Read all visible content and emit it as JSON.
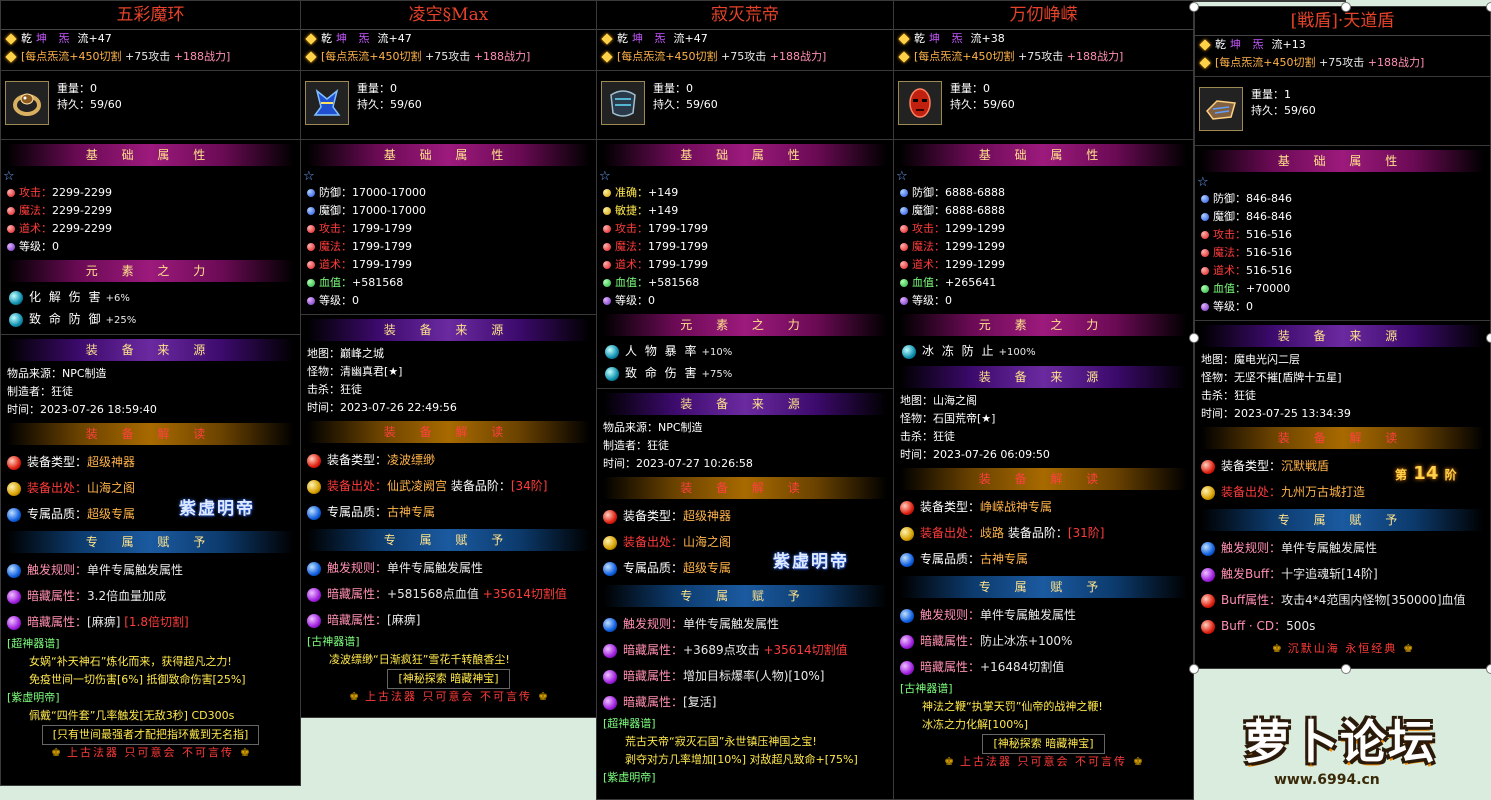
{
  "header_common": {
    "qian": "乾",
    "yinyang": "坤 炁",
    "liu": "流+",
    "bonus_a": "[每点炁流+450切割",
    "bonus_b": "+75攻击",
    "bonus_c": "+188战力]"
  },
  "labels": {
    "weight": "重量：",
    "durability": "持久：",
    "map": "地图：",
    "monster": "怪物：",
    "kill": "击杀：",
    "source": "物品来源：",
    "maker": "制造者：",
    "time": "时间："
  },
  "banners": {
    "basic": "基 础 属 性",
    "element": "元 素 之 力",
    "origin": "装 备 来 源",
    "decode": "装 备 解 读",
    "exclusive": "专 属 赋 予"
  },
  "badge": "紫虚明帝",
  "footer": "上古法器 只可意会 不可言传",
  "panels": [
    {
      "title": "五彩魔环",
      "level": "47",
      "weight": "0",
      "durability": "59/60",
      "stats": [
        {
          "label": "攻击：",
          "value": "2299-2299",
          "color": "#ff3b3b"
        },
        {
          "label": "魔法：",
          "value": "2299-2299",
          "color": "#ff3b3b"
        },
        {
          "label": "道术：",
          "value": "2299-2299",
          "color": "#ff3b3b"
        },
        {
          "label": "等级：",
          "value": "0",
          "color": "#ffffff"
        }
      ],
      "elements": [
        {
          "label": "化 解 伤 害",
          "value": "+6%"
        },
        {
          "label": "致 命 防 御",
          "value": "+25%"
        }
      ],
      "origin": {
        "source": "NPC制造",
        "maker": "狂徒",
        "time": "2023-07-26 18:59:40"
      },
      "decode": [
        {
          "label": "装备类型：",
          "value": "超级神器"
        },
        {
          "label": "装备出处：",
          "value": "山海之阁"
        },
        {
          "label": "专属品质：",
          "value": "超级专属"
        }
      ],
      "exclusive": [
        {
          "label": "触发规则：",
          "value": "单件专属触发属性"
        },
        {
          "label": "暗藏属性：",
          "value": "3.2倍血量加成"
        },
        {
          "label": "暗藏属性：",
          "value": "[麻痹]",
          "extra": "[1.8倍切割]"
        }
      ],
      "lore_title": "[超神器谱]",
      "lore": [
        "女娲“补天神石”炼化而来，获得超凡之力!",
        "免疫世间一切伤害[6%] 抵御致命伤害[25%]"
      ],
      "lore_title2": "[紫虚明帝]",
      "lore2": [
        "佩戴“四件套”几率触发[无敌3秒] CD300s"
      ],
      "boxed": "[只有世间最强者才配把指环戴到无名指]"
    },
    {
      "title": "凌空§Max",
      "level": "47",
      "weight": "0",
      "durability": "59/60",
      "stats": [
        {
          "label": "防御：",
          "value": "17000-17000",
          "color": "#ffffff"
        },
        {
          "label": "魔御：",
          "value": "17000-17000",
          "color": "#ffffff"
        },
        {
          "label": "攻击：",
          "value": "1799-1799",
          "color": "#ff3b3b"
        },
        {
          "label": "魔法：",
          "value": "1799-1799",
          "color": "#ff3b3b"
        },
        {
          "label": "道术：",
          "value": "1799-1799",
          "color": "#ff3b3b"
        },
        {
          "label": "血值：",
          "value": "+581568",
          "color": "#7cff7c"
        },
        {
          "label": "等级：",
          "value": "0",
          "color": "#ffffff"
        }
      ],
      "origin": {
        "map": "巅峰之城",
        "monster": "清幽真君[★]",
        "kill": "狂徒",
        "time": "2023-07-26 22:49:56"
      },
      "decode": [
        {
          "label": "装备类型：",
          "value": "凌波缥缈"
        },
        {
          "label": "装备出处：",
          "value": "仙武凌阙宫",
          "extra_label": "装备品阶：",
          "extra": "[34阶]"
        },
        {
          "label": "专属品质：",
          "value": "古神专属"
        }
      ],
      "exclusive": [
        {
          "label": "触发规则：",
          "value": "单件专属触发属性"
        },
        {
          "label": "暗藏属性：",
          "value": "+581568点血值",
          "extra": "+35614切割值"
        },
        {
          "label": "暗藏属性：",
          "value": "[麻痹]"
        }
      ],
      "lore_title": "[古神器谱]",
      "lore": [
        "凌波缥缈“日渐疯狂”雪花千转酿香尘!"
      ],
      "boxed": "[神秘探索 暗藏神宝]"
    },
    {
      "title": "寂灭荒帝",
      "level": "47",
      "weight": "0",
      "durability": "59/60",
      "stats": [
        {
          "label": "准确：",
          "value": "+149",
          "color": "#ffe84d"
        },
        {
          "label": "敏捷：",
          "value": "+149",
          "color": "#ffe84d"
        },
        {
          "label": "攻击：",
          "value": "1799-1799",
          "color": "#ff3b3b"
        },
        {
          "label": "魔法：",
          "value": "1799-1799",
          "color": "#ff3b3b"
        },
        {
          "label": "道术：",
          "value": "1799-1799",
          "color": "#ff3b3b"
        },
        {
          "label": "血值：",
          "value": "+581568",
          "color": "#7cff7c"
        },
        {
          "label": "等级：",
          "value": "0",
          "color": "#ffffff"
        }
      ],
      "elements": [
        {
          "label": "人 物 暴 率",
          "value": "+10%"
        },
        {
          "label": "致 命 伤 害",
          "value": "+75%"
        }
      ],
      "origin": {
        "source": "NPC制造",
        "maker": "狂徒",
        "time": "2023-07-27 10:26:58"
      },
      "decode": [
        {
          "label": "装备类型：",
          "value": "超级神器"
        },
        {
          "label": "装备出处：",
          "value": "山海之阁"
        },
        {
          "label": "专属品质：",
          "value": "超级专属"
        }
      ],
      "exclusive": [
        {
          "label": "触发规则：",
          "value": "单件专属触发属性"
        },
        {
          "label": "暗藏属性：",
          "value": "+3689点攻击",
          "extra": "+35614切割值"
        },
        {
          "label": "暗藏属性：",
          "value": "增加目标爆率(人物)[10%]"
        },
        {
          "label": "暗藏属性：",
          "value": "[复活]"
        }
      ],
      "lore_title": "[超神器谱]",
      "lore": [
        "荒古天帝“寂灭石国”永世镇压神国之宝!",
        "剥夺对方几率增加[10%] 对敌超凡致命+[75%]"
      ],
      "lore_title2": "[紫虚明帝]"
    },
    {
      "title": "万仞峥嵘",
      "level": "38",
      "weight": "0",
      "durability": "59/60",
      "stats": [
        {
          "label": "防御：",
          "value": "6888-6888",
          "color": "#ffffff"
        },
        {
          "label": "魔御：",
          "value": "6888-6888",
          "color": "#ffffff"
        },
        {
          "label": "攻击：",
          "value": "1299-1299",
          "color": "#ff3b3b"
        },
        {
          "label": "魔法：",
          "value": "1299-1299",
          "color": "#ff3b3b"
        },
        {
          "label": "道术：",
          "value": "1299-1299",
          "color": "#ff3b3b"
        },
        {
          "label": "血值：",
          "value": "+265641",
          "color": "#7cff7c"
        },
        {
          "label": "等级：",
          "value": "0",
          "color": "#ffffff"
        }
      ],
      "elements": [
        {
          "label": "冰 冻 防 止",
          "value": "+100%"
        }
      ],
      "origin": {
        "map": "山海之阁",
        "monster": "石国荒帝[★]",
        "kill": "狂徒",
        "time": "2023-07-26 06:09:50"
      },
      "decode": [
        {
          "label": "装备类型：",
          "value": "峥嵘战神专属"
        },
        {
          "label": "装备出处：",
          "value": "歧路",
          "extra_label": "装备品阶：",
          "extra": "[31阶]"
        },
        {
          "label": "专属品质：",
          "value": "古神专属"
        }
      ],
      "exclusive": [
        {
          "label": "触发规则：",
          "value": "单件专属触发属性"
        },
        {
          "label": "暗藏属性：",
          "value": "防止冰冻+100%"
        },
        {
          "label": "暗藏属性：",
          "value": "+16484切割值"
        }
      ],
      "lore_title": "[古神器谱]",
      "lore": [
        "神法之鞭“执掌天罚”仙帝的战神之鞭!",
        "冰冻之力化解[100%]"
      ],
      "boxed": "[神秘探索 暗藏神宝]"
    },
    {
      "title": "[戦盾]·天道盾",
      "level": "13",
      "weight": "1",
      "durability": "59/60",
      "stats": [
        {
          "label": "防御：",
          "value": "846-846",
          "color": "#ffffff"
        },
        {
          "label": "魔御：",
          "value": "846-846",
          "color": "#ffffff"
        },
        {
          "label": "攻击：",
          "value": "516-516",
          "color": "#ff3b3b"
        },
        {
          "label": "魔法：",
          "value": "516-516",
          "color": "#ff3b3b"
        },
        {
          "label": "道术：",
          "value": "516-516",
          "color": "#ff3b3b"
        },
        {
          "label": "血值：",
          "value": "+70000",
          "color": "#7cff7c"
        },
        {
          "label": "等级：",
          "value": "0",
          "color": "#ffffff"
        }
      ],
      "origin": {
        "map": "魔电光闪二层",
        "monster": "无坚不摧[盾牌十五星]",
        "kill": "狂徒",
        "time": "2023-07-25 13:34:39"
      },
      "decode": [
        {
          "label": "装备类型：",
          "value": "沉默戦盾"
        },
        {
          "label": "装备出处：",
          "value": "九州万古城打造"
        }
      ],
      "tier": {
        "pre": "第",
        "num": "14",
        "post": "阶"
      },
      "exclusive": [
        {
          "label": "触发规则：",
          "value": "单件专属触发属性"
        },
        {
          "label": "触发Buff：",
          "value": "十字追魂斩[14阶]"
        },
        {
          "label": "Buff属性：",
          "value": "攻击4*4范围内怪物[350000]血值"
        },
        {
          "label": "Buff · CD：",
          "value": "500s"
        }
      ],
      "footer": "沉默山海 永恒经典"
    }
  ],
  "watermark": {
    "name": "萝卜论坛",
    "url": "www.6994.cn"
  }
}
